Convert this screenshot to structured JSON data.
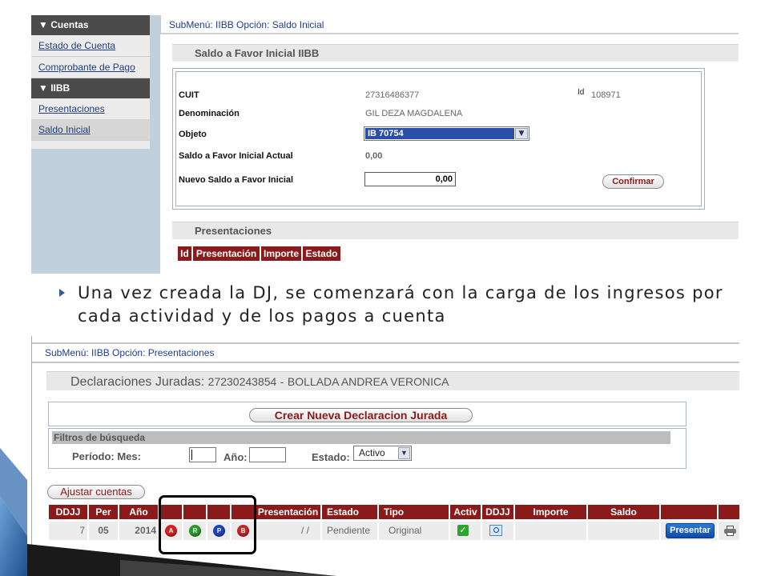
{
  "top": {
    "sidebar": {
      "groups": [
        {
          "title": "▼ Cuentas",
          "items": [
            "Estado de Cuenta",
            "Comprobante de Pago"
          ]
        },
        {
          "title": "▼ IIBB",
          "items": [
            "Presentaciones",
            "Saldo Inicial"
          ]
        }
      ]
    },
    "submenu": "SubMenú: IIBB Opción: Saldo Inicial",
    "section_title": "Saldo a Favor Inicial IIBB",
    "form": {
      "cuit_label": "CUIT",
      "cuit_value": "27316486377",
      "id_label": "Id",
      "id_value": "108971",
      "denominacion_label": "Denominación",
      "denominacion_value": "GIL DEZA MAGDALENA",
      "objeto_label": "Objeto",
      "objeto_value": "IB 70754",
      "saldo_actual_label": "Saldo a Favor Inicial Actual",
      "saldo_actual_value": "0,00",
      "nuevo_saldo_label": "Nuevo Saldo a Favor Inicial",
      "nuevo_saldo_value": "0,00",
      "confirm_label": "Confirmar"
    },
    "presentaciones_title": "Presentaciones",
    "table_headers": [
      "Id",
      "Presentación",
      "Importe",
      "Estado"
    ]
  },
  "bullet_text": "Una vez creada la DJ, se comenzará con la carga de los ingresos por cada actividad y de los pagos a cuenta",
  "bottom": {
    "submenu": "SubMenú: IIBB Opción: Presentaciones",
    "ddjj_label": "Declaraciones Juradas:",
    "ddjj_cuit": "27230243854",
    "ddjj_sep": "-",
    "ddjj_name": "BOLLADA ANDREA VERONICA",
    "crear_label": "Crear Nueva Declaracion Jurada",
    "filtros_title": "Filtros de búsqueda",
    "periodo_label": "Período: Mes:",
    "anio_label": "Año:",
    "estado_label": "Estado:",
    "estado_value": "Activo",
    "ajustar_label": "Ajustar cuentas",
    "table_headers": [
      "DDJJ",
      "Per",
      "Año",
      "",
      "",
      "",
      "",
      "Presentación",
      "Estado",
      "Tipo",
      "Activ",
      "DDJJ",
      "Importe",
      "Saldo",
      "",
      ""
    ],
    "row": {
      "ddjj": "7",
      "per": "05",
      "anio": "2014",
      "icons": [
        "A",
        "R",
        "P",
        "B"
      ],
      "presentacion": "/ /",
      "estado": "Pendiente",
      "tipo": "Original",
      "presentar_label": "Presentar"
    }
  },
  "colors": {
    "header_red": "#8b1b1b",
    "link_blue": "#1d3d8e",
    "icon_a": "#d42020",
    "icon_r": "#2a9a2a",
    "icon_p": "#1f44b8",
    "icon_b": "#c42626"
  }
}
